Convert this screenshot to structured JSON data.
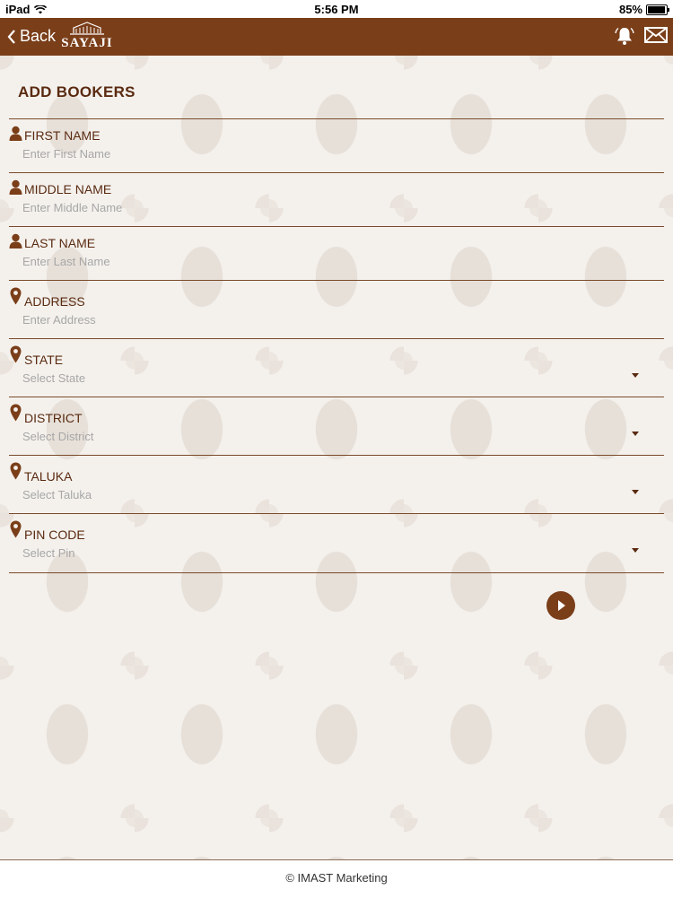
{
  "status_bar": {
    "device": "iPad",
    "time": "5:56 PM",
    "battery": "85%"
  },
  "nav": {
    "back_label": "Back",
    "logo_text": "SAYAJI",
    "icons": [
      "bell-icon",
      "mail-icon"
    ]
  },
  "page": {
    "title": "ADD BOOKERS"
  },
  "form": {
    "first_name": {
      "label": "FIRST NAME",
      "placeholder": "Enter First Name",
      "icon": "person-icon"
    },
    "middle_name": {
      "label": "MIDDLE NAME",
      "placeholder": "Enter Middle Name",
      "icon": "person-icon"
    },
    "last_name": {
      "label": "LAST NAME",
      "placeholder": "Enter Last Name",
      "icon": "person-icon"
    },
    "address": {
      "label": "ADDRESS",
      "placeholder": "Enter Address",
      "icon": "location-pin-icon"
    },
    "state": {
      "label": "STATE",
      "placeholder": "Select State",
      "icon": "location-pin-icon"
    },
    "district": {
      "label": "DISTRICT",
      "placeholder": "Select District",
      "icon": "location-pin-icon"
    },
    "taluka": {
      "label": "TALUKA",
      "placeholder": "Select Taluka",
      "icon": "location-pin-icon"
    },
    "pin_code": {
      "label": "PIN CODE",
      "placeholder": "Select Pin",
      "icon": "location-pin-icon"
    }
  },
  "footer": {
    "text": "© IMAST Marketing"
  },
  "colors": {
    "brand": "#7a3e19",
    "label": "#5a2a10",
    "placeholder": "#a7a7a7"
  }
}
